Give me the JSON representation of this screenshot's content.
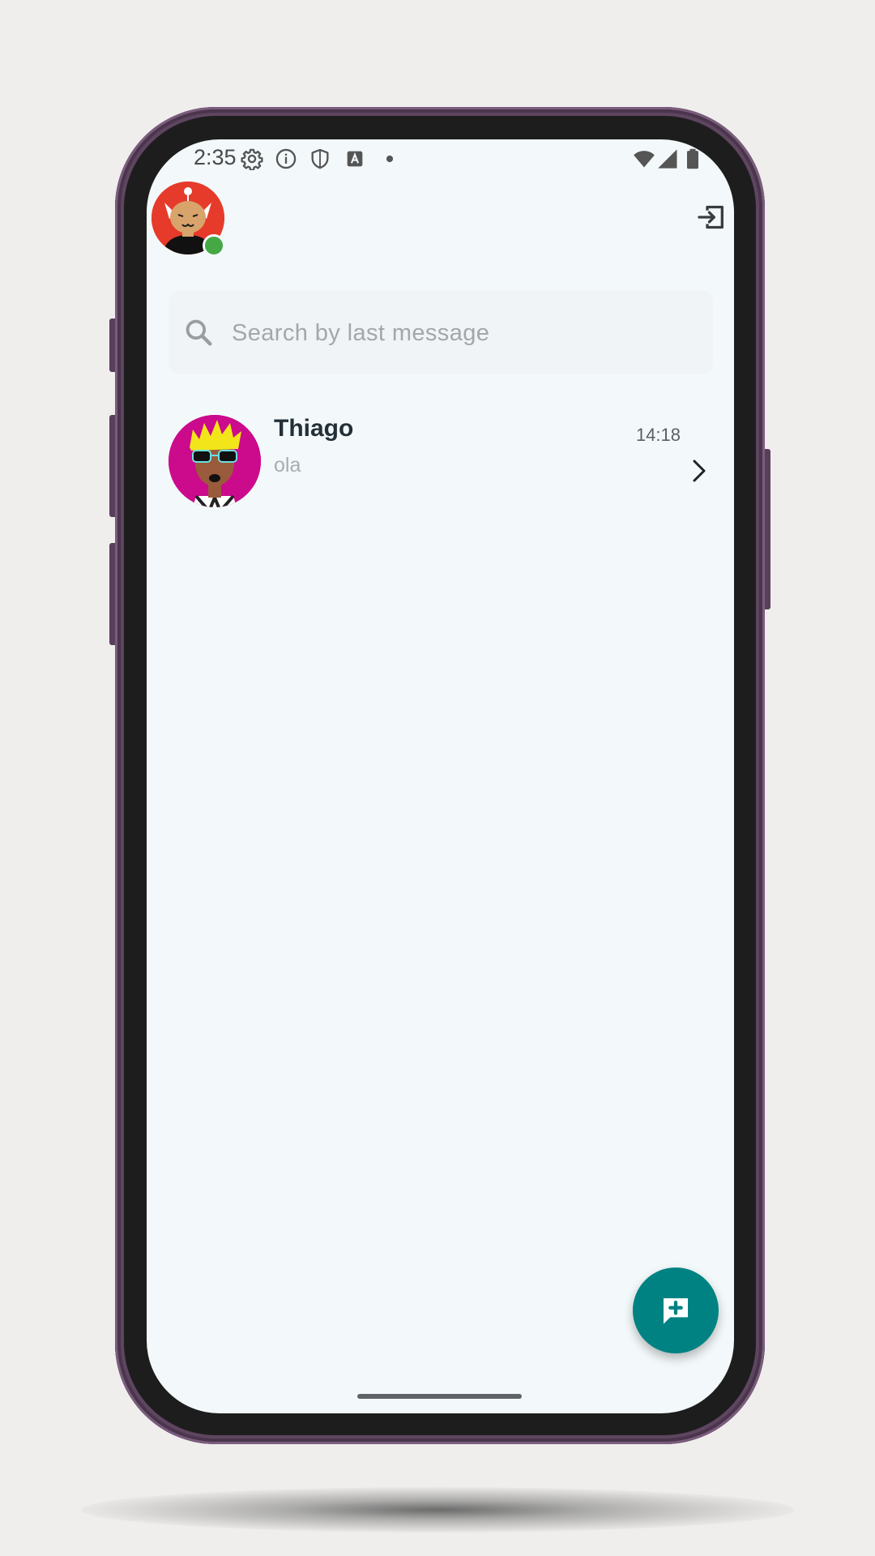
{
  "status_bar": {
    "time": "2:35",
    "left_icons": [
      "settings-icon",
      "info-icon",
      "shield-icon",
      "text-a-icon",
      "notification-dot-icon"
    ],
    "right_icons": [
      "wifi-icon",
      "cellular-signal-icon",
      "battery-icon"
    ]
  },
  "header": {
    "avatar": "user-avatar",
    "online": true,
    "logout_icon": "logout-icon"
  },
  "search": {
    "placeholder": "Search by last message",
    "value": ""
  },
  "chats": [
    {
      "name": "Thiago",
      "last_message": "ola",
      "time": "14:18"
    }
  ],
  "fab": {
    "icon": "add-chat-icon"
  },
  "colors": {
    "screen_bg": "#f3f9fa",
    "accent": "#008282",
    "online": "#45a845",
    "name_text": "#233038",
    "muted_text": "#a9acb0"
  }
}
